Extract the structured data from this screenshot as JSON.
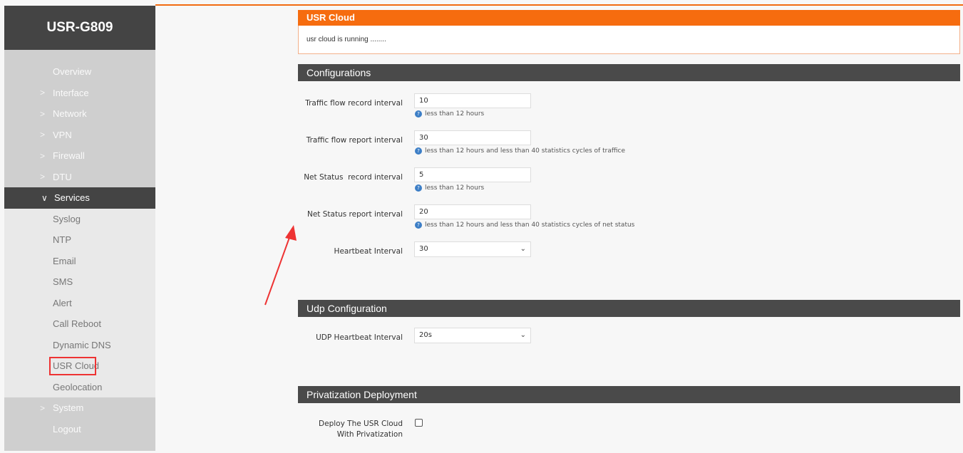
{
  "sidebar": {
    "brand": "USR-G809",
    "items": [
      {
        "label": "Overview",
        "chev": ""
      },
      {
        "label": "Interface",
        "chev": ">"
      },
      {
        "label": "Network",
        "chev": ">"
      },
      {
        "label": "VPN",
        "chev": ">"
      },
      {
        "label": "Firewall",
        "chev": ">"
      },
      {
        "label": "DTU",
        "chev": ">"
      },
      {
        "label": "Services",
        "chev": "∨"
      },
      {
        "label": "System",
        "chev": ">"
      },
      {
        "label": "Logout",
        "chev": ""
      }
    ],
    "services_sub": [
      "Syslog",
      "NTP",
      "Email",
      "SMS",
      "Alert",
      "Call Reboot",
      "Dynamic DNS",
      "USR Cloud",
      "Geolocation"
    ]
  },
  "cloud": {
    "title": "USR Cloud",
    "status": "usr cloud is running ........"
  },
  "configurations": {
    "title": "Configurations",
    "fields": [
      {
        "label": "Traffic flow record interval",
        "value": "10",
        "hint": "less than 12 hours"
      },
      {
        "label": "Traffic flow report interval",
        "value": "30",
        "hint": "less than 12 hours and less than 40 statistics cycles of traffice"
      },
      {
        "label": "Net Status  record interval",
        "value": "5",
        "hint": "less than 12 hours"
      },
      {
        "label": "Net Status report interval",
        "value": "20",
        "hint": "less than 12 hours and less than 40 statistics cycles of net status"
      }
    ],
    "heartbeat_label": "Heartbeat Interval",
    "heartbeat_value": "30"
  },
  "udp": {
    "title": "Udp Configuration",
    "label": "UDP Heartbeat Interval",
    "value": "20s"
  },
  "privatization": {
    "title": "Privatization Deployment",
    "label_line1": "Deploy The USR Cloud",
    "label_line2": "With Privatization"
  },
  "colors": {
    "accent": "#f66c0f",
    "highlight": "#e33333",
    "section": "#4a4a4a"
  }
}
